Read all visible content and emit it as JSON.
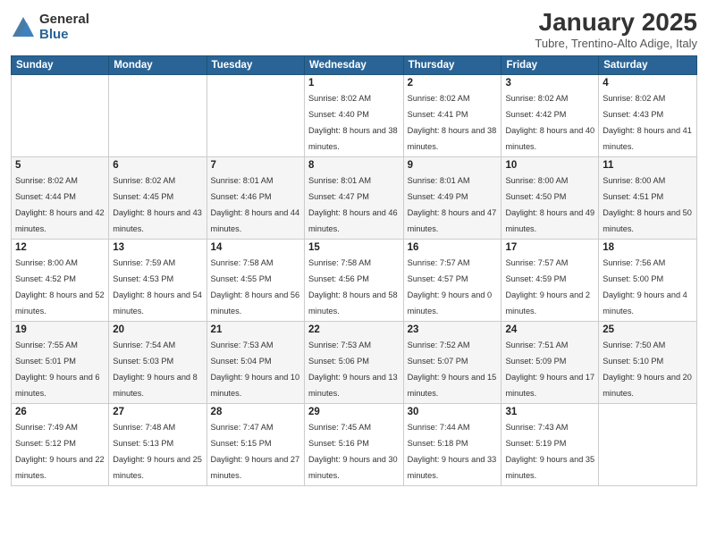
{
  "logo": {
    "general": "General",
    "blue": "Blue"
  },
  "header": {
    "month": "January 2025",
    "location": "Tubre, Trentino-Alto Adige, Italy"
  },
  "weekdays": [
    "Sunday",
    "Monday",
    "Tuesday",
    "Wednesday",
    "Thursday",
    "Friday",
    "Saturday"
  ],
  "weeks": [
    [
      {
        "day": "",
        "info": ""
      },
      {
        "day": "",
        "info": ""
      },
      {
        "day": "",
        "info": ""
      },
      {
        "day": "1",
        "info": "Sunrise: 8:02 AM\nSunset: 4:40 PM\nDaylight: 8 hours and 38 minutes."
      },
      {
        "day": "2",
        "info": "Sunrise: 8:02 AM\nSunset: 4:41 PM\nDaylight: 8 hours and 38 minutes."
      },
      {
        "day": "3",
        "info": "Sunrise: 8:02 AM\nSunset: 4:42 PM\nDaylight: 8 hours and 40 minutes."
      },
      {
        "day": "4",
        "info": "Sunrise: 8:02 AM\nSunset: 4:43 PM\nDaylight: 8 hours and 41 minutes."
      }
    ],
    [
      {
        "day": "5",
        "info": "Sunrise: 8:02 AM\nSunset: 4:44 PM\nDaylight: 8 hours and 42 minutes."
      },
      {
        "day": "6",
        "info": "Sunrise: 8:02 AM\nSunset: 4:45 PM\nDaylight: 8 hours and 43 minutes."
      },
      {
        "day": "7",
        "info": "Sunrise: 8:01 AM\nSunset: 4:46 PM\nDaylight: 8 hours and 44 minutes."
      },
      {
        "day": "8",
        "info": "Sunrise: 8:01 AM\nSunset: 4:47 PM\nDaylight: 8 hours and 46 minutes."
      },
      {
        "day": "9",
        "info": "Sunrise: 8:01 AM\nSunset: 4:49 PM\nDaylight: 8 hours and 47 minutes."
      },
      {
        "day": "10",
        "info": "Sunrise: 8:00 AM\nSunset: 4:50 PM\nDaylight: 8 hours and 49 minutes."
      },
      {
        "day": "11",
        "info": "Sunrise: 8:00 AM\nSunset: 4:51 PM\nDaylight: 8 hours and 50 minutes."
      }
    ],
    [
      {
        "day": "12",
        "info": "Sunrise: 8:00 AM\nSunset: 4:52 PM\nDaylight: 8 hours and 52 minutes."
      },
      {
        "day": "13",
        "info": "Sunrise: 7:59 AM\nSunset: 4:53 PM\nDaylight: 8 hours and 54 minutes."
      },
      {
        "day": "14",
        "info": "Sunrise: 7:58 AM\nSunset: 4:55 PM\nDaylight: 8 hours and 56 minutes."
      },
      {
        "day": "15",
        "info": "Sunrise: 7:58 AM\nSunset: 4:56 PM\nDaylight: 8 hours and 58 minutes."
      },
      {
        "day": "16",
        "info": "Sunrise: 7:57 AM\nSunset: 4:57 PM\nDaylight: 9 hours and 0 minutes."
      },
      {
        "day": "17",
        "info": "Sunrise: 7:57 AM\nSunset: 4:59 PM\nDaylight: 9 hours and 2 minutes."
      },
      {
        "day": "18",
        "info": "Sunrise: 7:56 AM\nSunset: 5:00 PM\nDaylight: 9 hours and 4 minutes."
      }
    ],
    [
      {
        "day": "19",
        "info": "Sunrise: 7:55 AM\nSunset: 5:01 PM\nDaylight: 9 hours and 6 minutes."
      },
      {
        "day": "20",
        "info": "Sunrise: 7:54 AM\nSunset: 5:03 PM\nDaylight: 9 hours and 8 minutes."
      },
      {
        "day": "21",
        "info": "Sunrise: 7:53 AM\nSunset: 5:04 PM\nDaylight: 9 hours and 10 minutes."
      },
      {
        "day": "22",
        "info": "Sunrise: 7:53 AM\nSunset: 5:06 PM\nDaylight: 9 hours and 13 minutes."
      },
      {
        "day": "23",
        "info": "Sunrise: 7:52 AM\nSunset: 5:07 PM\nDaylight: 9 hours and 15 minutes."
      },
      {
        "day": "24",
        "info": "Sunrise: 7:51 AM\nSunset: 5:09 PM\nDaylight: 9 hours and 17 minutes."
      },
      {
        "day": "25",
        "info": "Sunrise: 7:50 AM\nSunset: 5:10 PM\nDaylight: 9 hours and 20 minutes."
      }
    ],
    [
      {
        "day": "26",
        "info": "Sunrise: 7:49 AM\nSunset: 5:12 PM\nDaylight: 9 hours and 22 minutes."
      },
      {
        "day": "27",
        "info": "Sunrise: 7:48 AM\nSunset: 5:13 PM\nDaylight: 9 hours and 25 minutes."
      },
      {
        "day": "28",
        "info": "Sunrise: 7:47 AM\nSunset: 5:15 PM\nDaylight: 9 hours and 27 minutes."
      },
      {
        "day": "29",
        "info": "Sunrise: 7:45 AM\nSunset: 5:16 PM\nDaylight: 9 hours and 30 minutes."
      },
      {
        "day": "30",
        "info": "Sunrise: 7:44 AM\nSunset: 5:18 PM\nDaylight: 9 hours and 33 minutes."
      },
      {
        "day": "31",
        "info": "Sunrise: 7:43 AM\nSunset: 5:19 PM\nDaylight: 9 hours and 35 minutes."
      },
      {
        "day": "",
        "info": ""
      }
    ]
  ]
}
